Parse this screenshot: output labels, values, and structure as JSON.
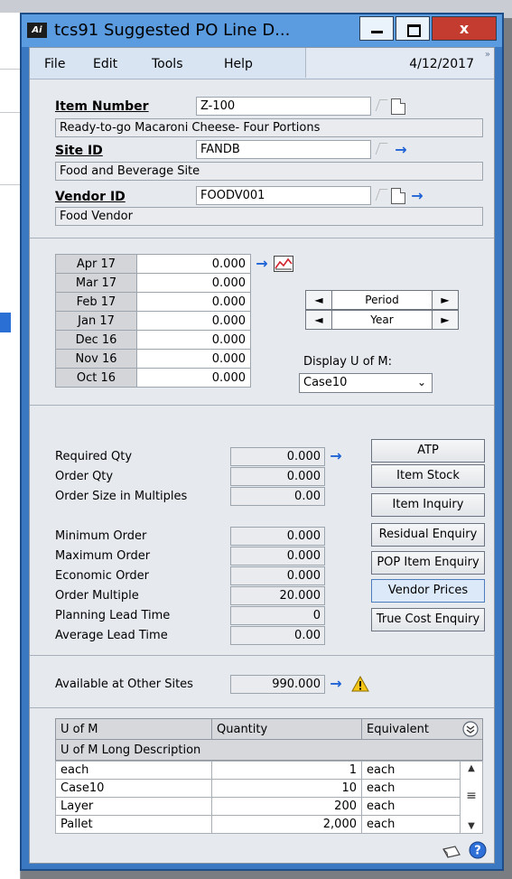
{
  "window": {
    "title": "tcs91 Suggested PO Line D...",
    "close_glyph": "x",
    "app_logo": "Ai"
  },
  "menu": {
    "file": "File",
    "edit": "Edit",
    "tools": "Tools",
    "help": "Help",
    "date": "4/12/2017",
    "more": "»"
  },
  "item": {
    "item_number_label": "Item Number",
    "item_number": "Z-100",
    "item_description": "Ready-to-go Macaroni Cheese- Four Portions",
    "site_label": "Site ID",
    "site_id": "FANDB",
    "site_description": "Food and Beverage Site",
    "vendor_label": "Vendor ID",
    "vendor_id": "FOODV001",
    "vendor_description": "Food Vendor"
  },
  "periods": [
    {
      "label": "Apr 17",
      "value": "0.000"
    },
    {
      "label": "Mar 17",
      "value": "0.000"
    },
    {
      "label": "Feb 17",
      "value": "0.000"
    },
    {
      "label": "Jan 17",
      "value": "0.000"
    },
    {
      "label": "Dec 16",
      "value": "0.000"
    },
    {
      "label": "Nov 16",
      "value": "0.000"
    },
    {
      "label": "Oct 16",
      "value": "0.000"
    }
  ],
  "nav": {
    "period": "Period",
    "year": "Year",
    "left": "◄",
    "right": "►"
  },
  "uom_select": {
    "label": "Display U of M:",
    "value": "Case10"
  },
  "quantities": {
    "required_qty_label": "Required Qty",
    "required_qty": "0.000",
    "order_qty_label": "Order Qty",
    "order_qty": "0.000",
    "order_size_label": "Order Size in Multiples",
    "order_size": "0.00",
    "minimum_order_label": "Minimum Order",
    "minimum_order": "0.000",
    "maximum_order_label": "Maximum Order",
    "maximum_order": "0.000",
    "economic_order_label": "Economic Order",
    "economic_order": "0.000",
    "order_multiple_label": "Order Multiple",
    "order_multiple": "20.000",
    "planning_lead_label": "Planning Lead Time",
    "planning_lead": "0",
    "average_lead_label": "Average Lead Time",
    "average_lead": "0.00",
    "available_label": "Available at Other Sites",
    "available": "990.000"
  },
  "buttons": {
    "atp": "ATP",
    "item_stock": "Item Stock",
    "item_inquiry": "Item Inquiry",
    "residual_enquiry": "Residual Enquiry",
    "pop_item_enquiry": "POP Item Enquiry",
    "vendor_prices": "Vendor Prices",
    "true_cost_enquiry": "True Cost Enquiry"
  },
  "grid": {
    "headers": {
      "uom": "U of M",
      "quantity": "Quantity",
      "equivalent": "Equivalent",
      "long_desc": "U of M Long Description"
    },
    "rows": [
      {
        "uom": "each",
        "quantity": "1",
        "equivalent": "each"
      },
      {
        "uom": "Case10",
        "quantity": "10",
        "equivalent": "each"
      },
      {
        "uom": "Layer",
        "quantity": "200",
        "equivalent": "each"
      },
      {
        "uom": "Pallet",
        "quantity": "2,000",
        "equivalent": "each"
      }
    ]
  },
  "colors": {
    "accent": "#1f63d6",
    "title_bar": "#5b9be0",
    "close": "#c43b30"
  }
}
